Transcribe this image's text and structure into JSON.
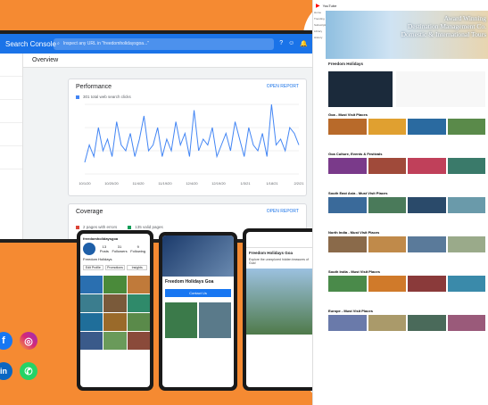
{
  "search_console": {
    "title": "Search Console",
    "search_placeholder": "Inspect any URL in \"freedomholidaysgoa...\"",
    "overview": "Overview",
    "performance": {
      "title": "Performance",
      "open_report": "OPEN REPORT",
      "legend": "301 total web search clicks"
    },
    "coverage": {
      "title": "Coverage",
      "open_report": "OPEN REPORT",
      "legend_errors": "2 pages with errors",
      "legend_valid": "135 valid pages"
    }
  },
  "instagram": {
    "handle": "freedomholidaysgoa",
    "stats": [
      {
        "n": "13",
        "l": "Posts"
      },
      {
        "n": "31",
        "l": "Followers"
      },
      {
        "n": "9",
        "l": "Following"
      }
    ],
    "name": "Freedom Holidays",
    "buttons": [
      "Edit Profile",
      "Promotions",
      "Insights"
    ]
  },
  "facebook_page": {
    "title": "Freedom Holidays Goa",
    "action": "Contact Us"
  },
  "facebook_post": {
    "title": "Freedom Holidays Goa",
    "text": "Explore the unexplored hidden treasures of Goa!"
  },
  "youtube": {
    "brand": "YouTube",
    "banner": [
      "Award Winning",
      "Destination Management Co.",
      "Domestic & International Tours"
    ],
    "channel": "Freedom Holidays",
    "sections": [
      "Goa - Must Visit Places",
      "Goa Culture, Events & Festivals",
      "South East Asia - Must Visit Places",
      "North India - Must Visit Places",
      "South India - Must Visit Places",
      "Europe - Must Visit Places"
    ],
    "sidebar": [
      "Home",
      "Trending",
      "Subscriptions",
      "Library",
      "History"
    ]
  },
  "chart_data": {
    "type": "line",
    "title": "Performance",
    "series": [
      {
        "name": "301 total web search clicks",
        "values": [
          2,
          5,
          3,
          8,
          4,
          6,
          3,
          9,
          5,
          4,
          7,
          3,
          6,
          10,
          4,
          5,
          8,
          3,
          6,
          4,
          9,
          5,
          7,
          3,
          11,
          4,
          6,
          5,
          8,
          3,
          5,
          7,
          4,
          9,
          6,
          3,
          8,
          5,
          4,
          7,
          3,
          12,
          5,
          6,
          4,
          8,
          7,
          5
        ]
      }
    ],
    "x": [
      "10/1/20",
      "10/20/20",
      "11/4/20",
      "11/19/20",
      "12/4/20",
      "12/19/20",
      "1/3/21",
      "1/18/21",
      "2/2/21"
    ],
    "colors": {
      "line": "#4285f4"
    }
  }
}
